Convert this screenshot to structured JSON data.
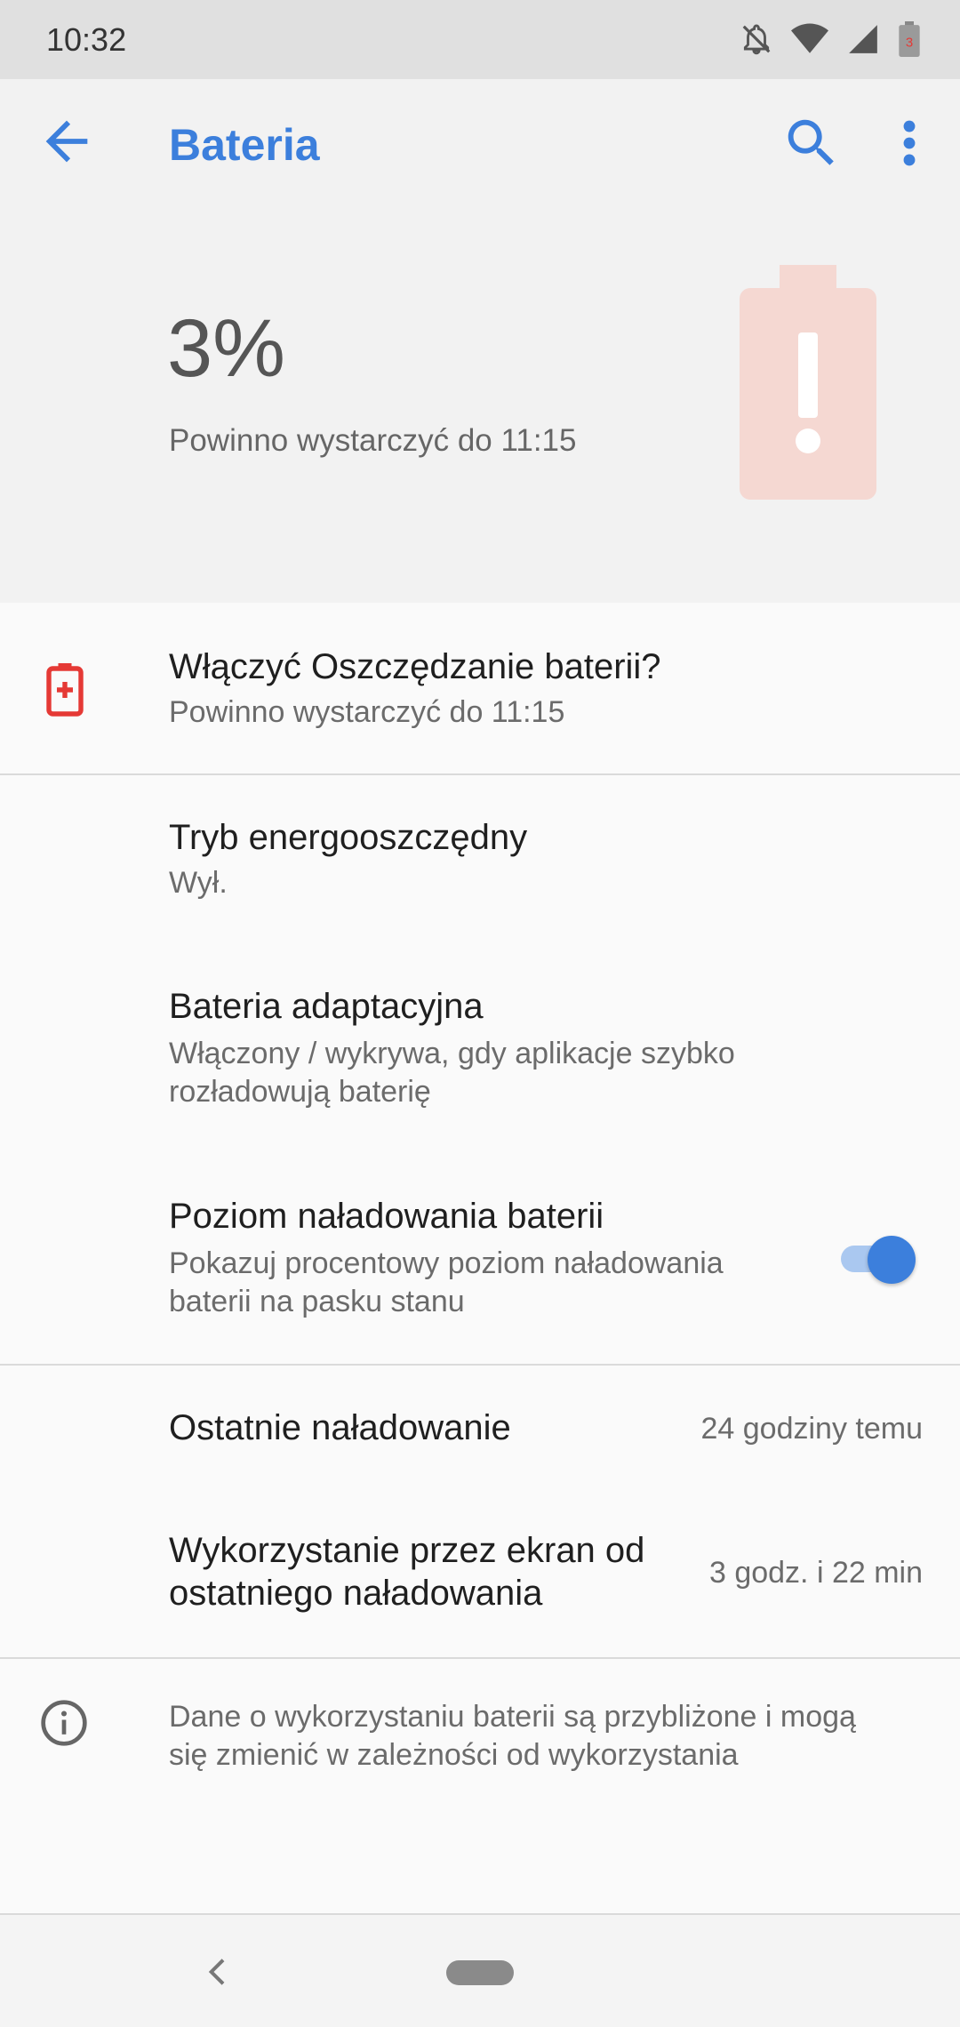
{
  "status_bar": {
    "time": "10:32",
    "icons": [
      "notifications-off-icon",
      "wifi-icon",
      "signal-icon",
      "battery-low-icon"
    ],
    "battery_level_text": "3"
  },
  "app_bar": {
    "title": "Bateria",
    "accent_color": "#3c7fdc"
  },
  "header": {
    "percent": "3%",
    "estimate": "Powinno wystarczyć do 11:15",
    "battery_level": 0.03
  },
  "suggestion": {
    "title": "Włączyć Oszczędzanie baterii?",
    "subtitle": "Powinno wystarczyć do 11:15",
    "icon": "battery-saver-plus-icon",
    "icon_color": "#e53935"
  },
  "settings": [
    {
      "title": "Tryb energooszczędny",
      "subtitle": "Wył."
    },
    {
      "title": "Bateria adaptacyjna",
      "subtitle_line1": "Włączony / wykrywa, gdy aplikacje szybko",
      "subtitle_line2": "rozładowują baterię"
    },
    {
      "title": "Poziom naładowania baterii",
      "subtitle_line1": "Pokazuj procentowy poziom naładowania",
      "subtitle_line2": "baterii na pasku stanu",
      "toggle_on": true
    }
  ],
  "usage": [
    {
      "title": "Ostatnie naładowanie",
      "value": "24 godziny temu"
    },
    {
      "title_line1": "Wykorzystanie przez ekran od",
      "title_line2": "ostatniego naładowania",
      "value": "3 godz. i 22 min"
    }
  ],
  "footer_info": {
    "icon": "info-icon",
    "line1": "Dane o wykorzystaniu baterii są przybliżone i mogą",
    "line2": "się zmienić w zależności od wykorzystania"
  }
}
